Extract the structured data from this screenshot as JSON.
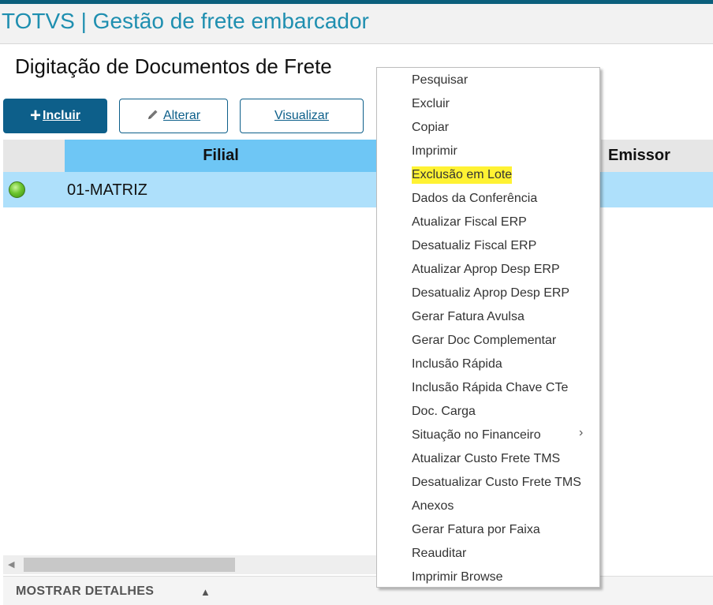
{
  "app": {
    "title": "TOTVS | Gestão de frete embarcador"
  },
  "page": {
    "title": "Digitação de Documentos de Frete"
  },
  "toolbar": {
    "incluir": {
      "plus": "+",
      "label": "Incluir"
    },
    "alterar": {
      "label": "Alterar"
    },
    "visualizar": {
      "label": "Visualizar"
    }
  },
  "grid": {
    "columns": [
      "Filial",
      "Emissor"
    ],
    "rows": [
      {
        "status": "green",
        "filial": "01-MATRIZ"
      }
    ]
  },
  "footer": {
    "details_label": "MOSTRAR DETALHES",
    "arrow": "▲"
  },
  "context_menu": {
    "items": [
      {
        "label": "Pesquisar"
      },
      {
        "label": "Excluir"
      },
      {
        "label": "Copiar"
      },
      {
        "label": "Imprimir"
      },
      {
        "label": "Exclusão em Lote",
        "highlighted": true
      },
      {
        "label": "Dados da Conferência"
      },
      {
        "label": "Atualizar Fiscal ERP"
      },
      {
        "label": "Desatualiz Fiscal ERP"
      },
      {
        "label": "Atualizar Aprop Desp ERP"
      },
      {
        "label": "Desatualiz Aprop Desp ERP"
      },
      {
        "label": "Gerar Fatura Avulsa"
      },
      {
        "label": "Gerar Doc Complementar"
      },
      {
        "label": "Inclusão Rápida"
      },
      {
        "label": "Inclusão Rápida Chave CTe"
      },
      {
        "label": "Doc. Carga"
      },
      {
        "label": "Situação no Financeiro",
        "submenu": true
      },
      {
        "label": "Atualizar Custo Frete TMS"
      },
      {
        "label": "Desatualizar Custo Frete TMS"
      },
      {
        "label": "Anexos"
      },
      {
        "label": "Gerar Fatura por Faixa"
      },
      {
        "label": "Reauditar"
      },
      {
        "label": "Imprimir Browse"
      }
    ],
    "submenu_arrow": "›"
  },
  "colors": {
    "brand": "#1f8fb0",
    "primary_button": "#0d5f8a",
    "grid_header_active": "#6ec6f5",
    "row_selected": "#aee0fb",
    "highlight": "#fff233",
    "status_ok": "#6cc52e"
  }
}
